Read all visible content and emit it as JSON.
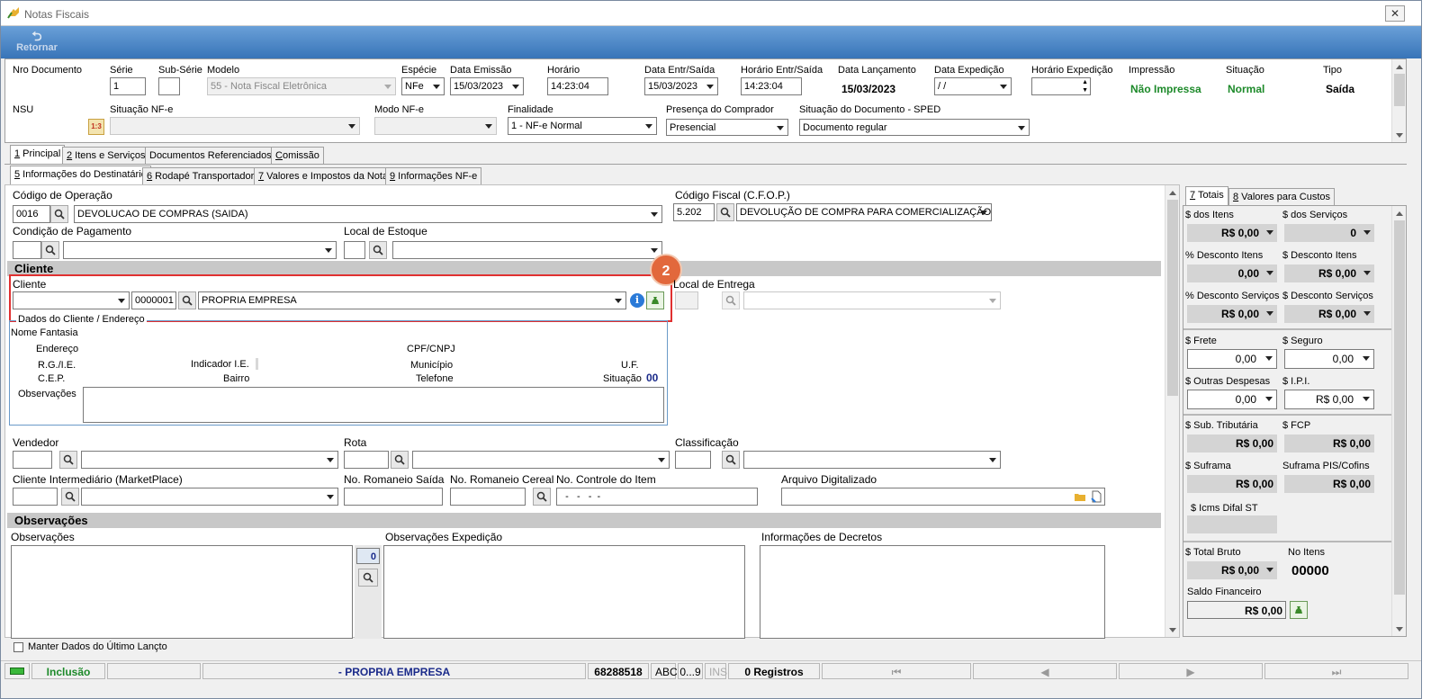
{
  "window": {
    "title": "Notas Fiscais",
    "close": "✕"
  },
  "toolbar": {
    "retornar": "Retornar"
  },
  "header": {
    "nro_documento": "Nro Documento",
    "serie_label": "Série",
    "serie_value": "1",
    "subserie_label": "Sub-Série",
    "modelo_label": "Modelo",
    "modelo_value": "55 - Nota Fiscal Eletrônica",
    "especie_label": "Espécie",
    "especie_value": "NFe",
    "data_emissao_label": "Data Emissão",
    "data_emissao_value": "15/03/2023",
    "horario_label": "Horário",
    "horario_value": "14:23:04",
    "data_entr_label": "Data Entr/Saída",
    "data_entr_value": "15/03/2023",
    "horario_entr_label": "Horário Entr/Saída",
    "horario_entr_value": "14:23:04",
    "data_lanc_label": "Data Lançamento",
    "data_lanc_value": "15/03/2023",
    "data_exp_label": "Data Expedição",
    "data_exp_value": " / /",
    "horario_exp_label": "Horário Expedição",
    "impressao_label": "Impressão",
    "impressao_value": "Não Impressa",
    "situacao_label": "Situação",
    "situacao_value": "Normal",
    "tipo_label": "Tipo",
    "tipo_value": "Saída",
    "nsu_label": "NSU",
    "situacao_nfe_label": "Situação NF-e",
    "modo_nfe_label": "Modo NF-e",
    "finalidade_label": "Finalidade",
    "finalidade_value": "1 - NF-e Normal",
    "presenca_label": "Presença do Comprador",
    "presenca_value": "Presencial",
    "sit_doc_label": "Situação do Documento - SPED",
    "sit_doc_value": "Documento regular"
  },
  "tabs1": [
    {
      "key": "1",
      "label": " Principal"
    },
    {
      "key": "2",
      "label": " Itens e Serviços"
    },
    {
      "key": "",
      "label": "Documentos Referenciados"
    },
    {
      "key": "C",
      "label": "omissão"
    }
  ],
  "tabs2": [
    {
      "key": "5",
      "label": " Informações do Destinatário"
    },
    {
      "key": "6",
      "label": " Rodapé Transportador"
    },
    {
      "key": "7",
      "label": " Valores e Impostos da Nota"
    },
    {
      "key": "9",
      "label": " Informações NF-e"
    }
  ],
  "main": {
    "cod_operacao_label": "Código de Operação",
    "cod_operacao_code": "0016",
    "cod_operacao_desc": "DEVOLUCAO DE COMPRAS (SAIDA)",
    "cfop_label": "Código Fiscal (C.F.O.P.)",
    "cfop_code": "5.202",
    "cfop_desc": "DEVOLUÇÃO DE COMPRA PARA COMERCIALIZAÇÃO",
    "cond_pag_label": "Condição de Pagamento",
    "local_estoque_label": "Local de Estoque",
    "cliente_section": "Cliente",
    "cliente_label": "Cliente",
    "cliente_code": "0000001",
    "cliente_name": "PROPRIA EMPRESA",
    "local_entrega_label": "Local de Entrega",
    "badge": "2",
    "dados_cliente_label": "Dados do Cliente / Endereço",
    "nome_fantasia": "Nome Fantasia",
    "endereco": "Endereço",
    "cpf_cnpj": "CPF/CNPJ",
    "rg_ie": "R.G./I.E.",
    "indicador_ie": "Indicador I.E.",
    "municipio": "Município",
    "uf": "U.F.",
    "cep": "C.E.P.",
    "bairro": "Bairro",
    "telefone": "Telefone",
    "situacao": "Situação",
    "situacao_value": "00",
    "observacoes_label": "Observações",
    "vendedor_label": "Vendedor",
    "rota_label": "Rota",
    "classificacao_label": "Classificação",
    "cliente_inter_label": "Cliente Intermediário (MarketPlace)",
    "romaneio_saida_label": "No. Romaneio Saída",
    "romaneio_cereal_label": "No. Romaneio Cereal",
    "controle_item_label": "No. Controle do Item",
    "controle_item_value": "  -   -   -  -",
    "arquivo_label": "Arquivo Digitalizado",
    "obs_section": "Observações",
    "obs_label": "Observações",
    "obs_count": "0",
    "obs_exp_label": "Observações Expedição",
    "info_decretos_label": "Informações de Decretos",
    "manter_dados": "Manter Dados do Último Lançto"
  },
  "totals": {
    "tab1_key": "7",
    "tab1": " Totais",
    "tab2_key": "8",
    "tab2": " Valores para Custos",
    "dos_itens_label": "$ dos Itens",
    "dos_itens": "R$ 0,00",
    "dos_servicos_label": "$ dos Serviços",
    "dos_servicos": "0",
    "desc_itens_pct_label": "% Desconto Itens",
    "desc_itens_pct": "0,00",
    "desc_itens_label": "$ Desconto Itens",
    "desc_itens": "R$ 0,00",
    "desc_serv_pct_label": "% Desconto Serviços",
    "desc_serv_pct": "R$ 0,00",
    "desc_serv_label": "$ Desconto Serviços",
    "desc_serv": "R$ 0,00",
    "frete_label": "$ Frete",
    "frete": "0,00",
    "seguro_label": "$ Seguro",
    "seguro": "0,00",
    "outras_label": "$ Outras Despesas",
    "outras": "0,00",
    "ipi_label": "$ I.P.I.",
    "ipi": "R$ 0,00",
    "sub_trib_label": "$ Sub. Tributária",
    "sub_trib": "R$ 0,00",
    "fcp_label": "$ FCP",
    "fcp": "R$ 0,00",
    "suframa_label": "$ Suframa",
    "suframa": "R$ 0,00",
    "suframa_pis_label": "Suframa PIS/Cofins",
    "suframa_pis": "R$ 0,00",
    "icms_difal_label": "$ Icms Difal ST",
    "total_bruto_label": "$ Total Bruto",
    "total_bruto": "R$ 0,00",
    "no_itens_label": "No Itens",
    "no_itens": "00000",
    "saldo_label": "Saldo Financeiro",
    "saldo": "R$ 0,00"
  },
  "statusbar": {
    "mode": "Inclusão",
    "company": "- PROPRIA EMPRESA",
    "code": "68288518",
    "abc": "ABC",
    "num": "0...9",
    "ins": "INS",
    "registros": "0 Registros"
  }
}
